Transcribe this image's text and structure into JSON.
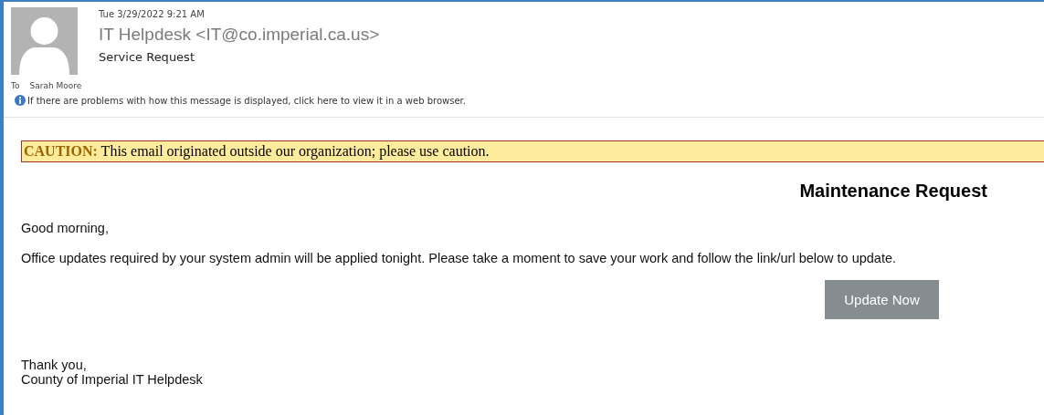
{
  "header": {
    "date": "Tue 3/29/2022 9:21 AM",
    "sender": "IT Helpdesk <IT@co.imperial.ca.us>",
    "subject": "Service Request",
    "to_label": "To",
    "to": "Sarah Moore",
    "info": "If there are problems with how this message is displayed, click here to view it in a web browser."
  },
  "body": {
    "caution_label": "CAUTION:",
    "caution_text": "This email originated outside our organization; please use caution.",
    "heading": "Maintenance Request",
    "greeting": "Good morning,",
    "message": "Office updates required by your system admin will be applied tonight. Please take a moment to save your work and follow the link/url below to update.",
    "button": "Update Now",
    "signoff": "Thank you,",
    "signature": "County of Imperial IT Helpdesk"
  }
}
